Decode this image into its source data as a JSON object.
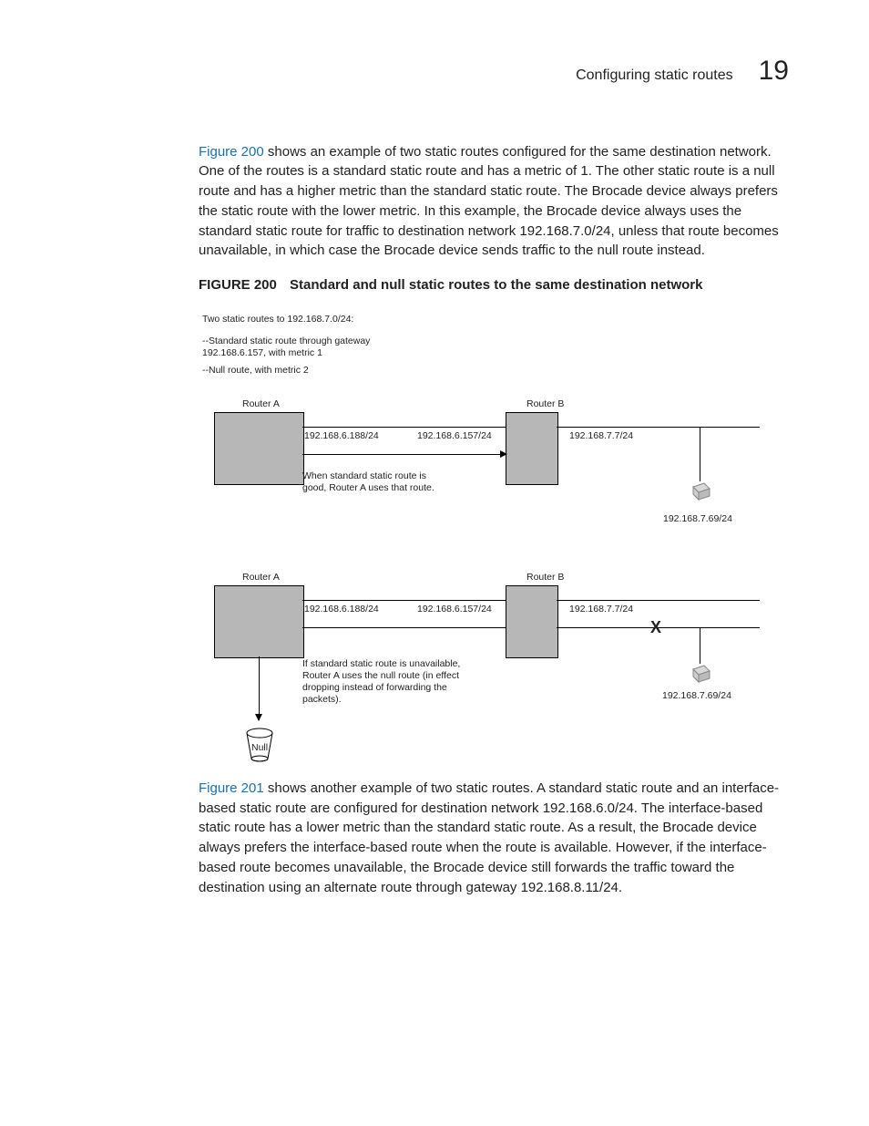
{
  "header": {
    "section": "Configuring static routes",
    "page_number": "19"
  },
  "para1_a": "Figure 200",
  "para1_b": " shows an example of two static routes configured for the same destination network. One of the routes is a standard static route and has a metric of 1. The other static route is a null route and has a higher metric than the standard static route. The Brocade device always prefers the static route with the lower metric. In this example, the Brocade device always uses the standard static route for traffic to destination network 192.168.7.0/24, unless that route becomes unavailable, in which case the Brocade device sends traffic to the null route instead.",
  "fig200": {
    "word": "FIGURE",
    "num": "200",
    "title": "Standard and null static routes to the same destination network"
  },
  "diagram": {
    "intro": "Two static routes to 192.168.7.0/24:",
    "intro2": "--Standard static route through gateway 192.168.6.157, with metric 1",
    "intro3": "--Null route, with metric 2",
    "routerA": "Router A",
    "routerB": "Router B",
    "ipA": "192.168.6.188/24",
    "ipB": "192.168.6.157/24",
    "ipC": "192.168.7.7/24",
    "ipD": "192.168.7.69/24",
    "capA": "When standard static route is good, Router A uses that route.",
    "capB": "If standard static route is unavailable, Router A uses the null route (in effect dropping instead of forwarding the packets).",
    "nullLabel": "Null",
    "x": "X"
  },
  "para2_a": "Figure 201",
  "para2_b": " shows another example of two static routes. A standard static route and an interface-based static route are configured for destination network 192.168.6.0/24. The interface-based static route has a lower metric than the standard static route. As a result, the Brocade device always prefers the interface-based route when the route is available. However, if the interface-based route becomes unavailable, the Brocade device still forwards the traffic toward the destination using an alternate route through gateway 192.168.8.11/24."
}
